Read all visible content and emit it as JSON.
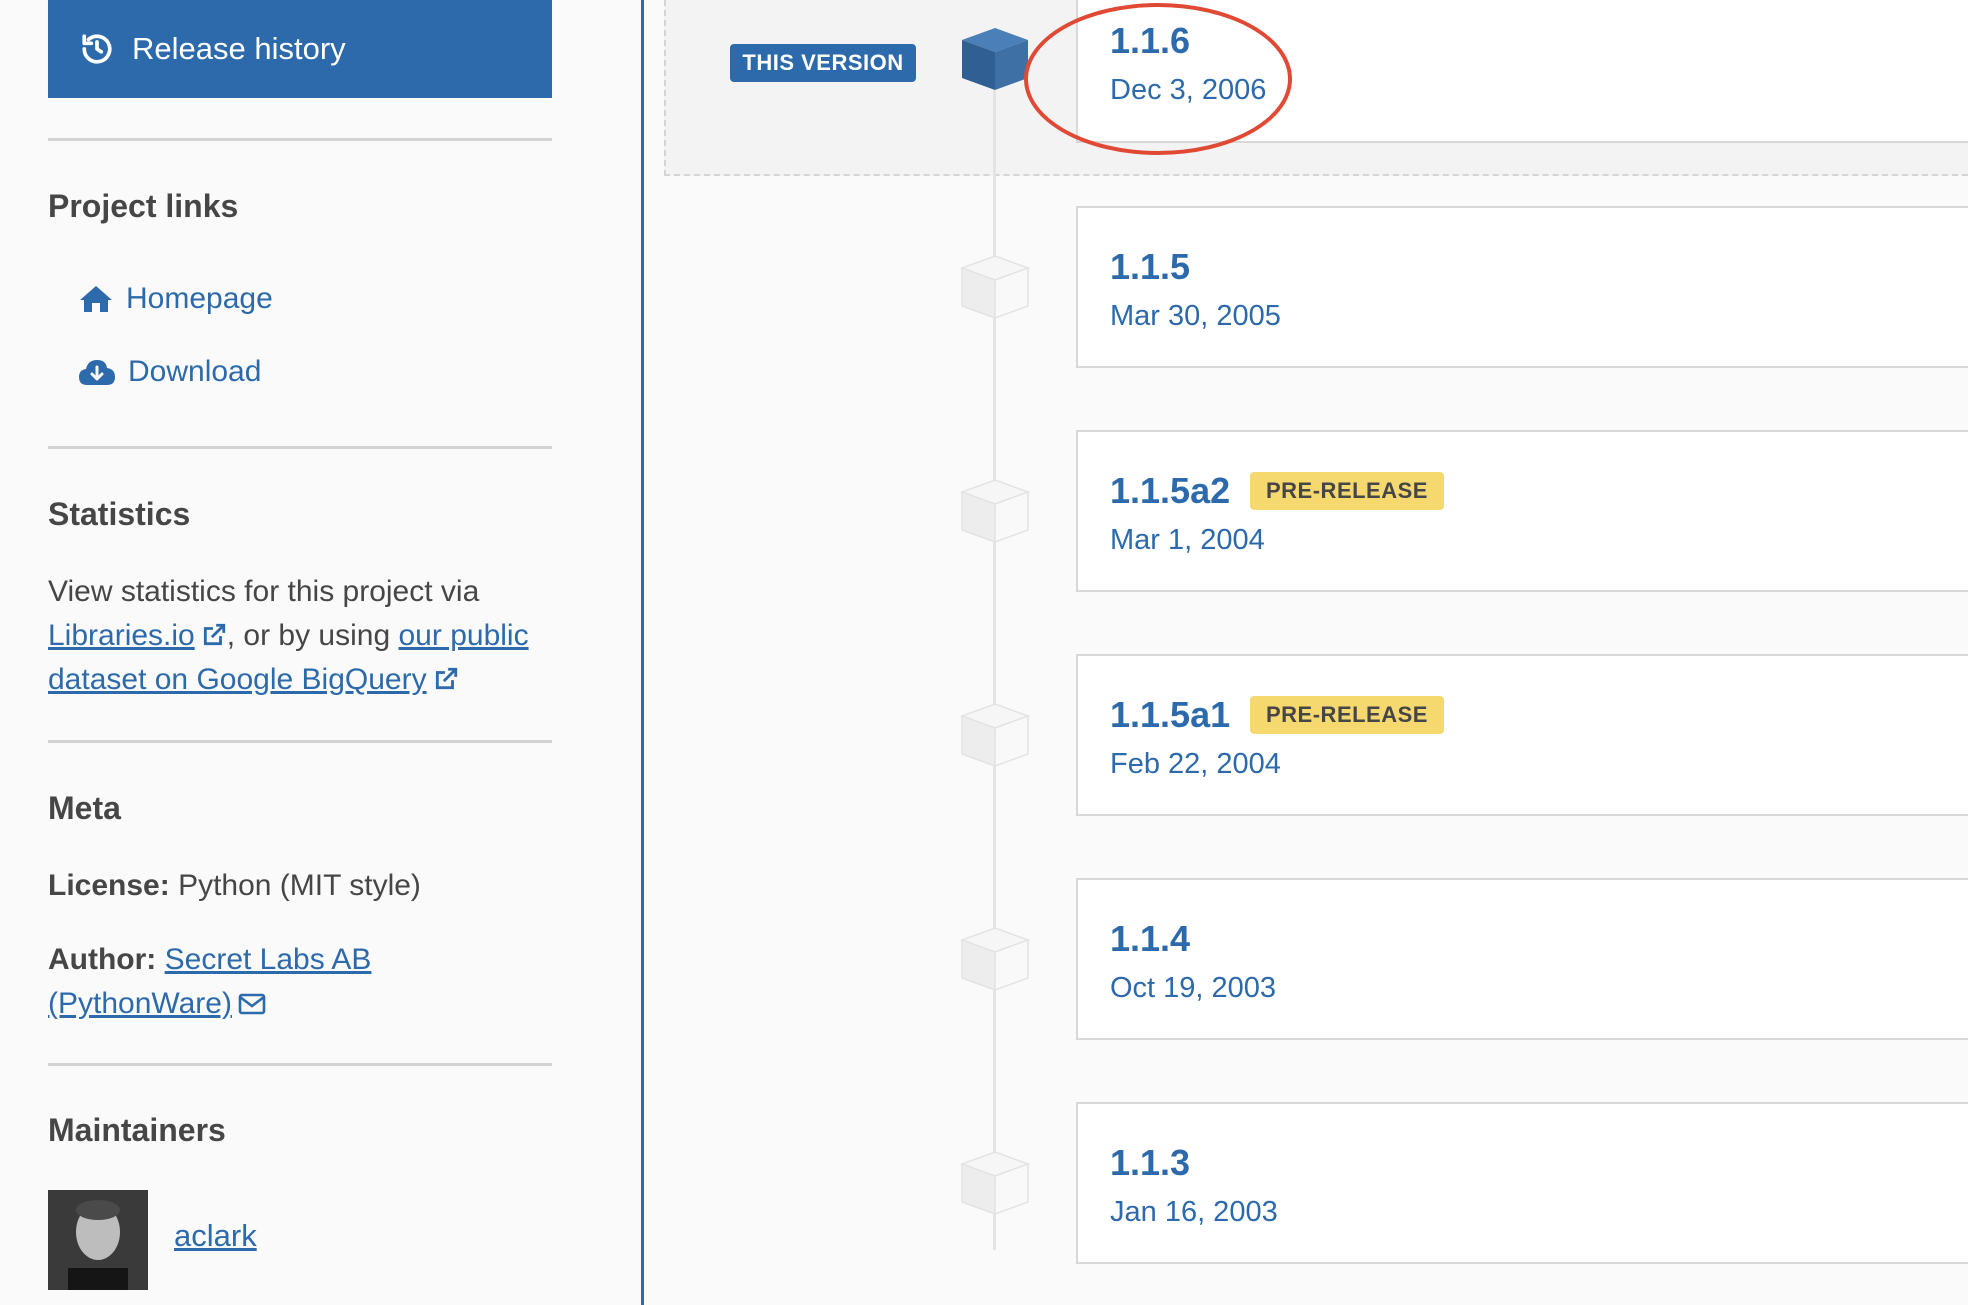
{
  "sidebar": {
    "release_history_label": "Release history",
    "project_links_title": "Project links",
    "links": [
      {
        "label": "Homepage",
        "icon": "home-icon"
      },
      {
        "label": "Download",
        "icon": "cloud-download-icon"
      }
    ],
    "statistics_title": "Statistics",
    "statistics_text_1": "View statistics for this project via",
    "statistics_link_1": "Libraries.io",
    "statistics_text_2": ", or by using",
    "statistics_link_2a": "our public",
    "statistics_link_2b": "dataset on Google BigQuery",
    "meta_title": "Meta",
    "license_label": "License:",
    "license_value": "Python (MIT style)",
    "author_label": "Author:",
    "author_value_1": "Secret Labs AB",
    "author_value_2": "(PythonWare)",
    "maintainers_title": "Maintainers",
    "maintainer": "aclark"
  },
  "colors": {
    "accent": "#2c6aab",
    "prerelease_badge": "#f5d96f",
    "annotation_circle": "#e04a35"
  },
  "this_version_label": "THIS VERSION",
  "prerelease_label": "PRE-RELEASE",
  "releases": [
    {
      "version": "1.1.6",
      "date": "Dec 3, 2006",
      "current": true,
      "prerelease": false
    },
    {
      "version": "1.1.5",
      "date": "Mar 30, 2005",
      "current": false,
      "prerelease": false
    },
    {
      "version": "1.1.5a2",
      "date": "Mar 1, 2004",
      "current": false,
      "prerelease": true
    },
    {
      "version": "1.1.5a1",
      "date": "Feb 22, 2004",
      "current": false,
      "prerelease": true
    },
    {
      "version": "1.1.4",
      "date": "Oct 19, 2003",
      "current": false,
      "prerelease": false
    },
    {
      "version": "1.1.3",
      "date": "Jan 16, 2003",
      "current": false,
      "prerelease": false
    }
  ]
}
